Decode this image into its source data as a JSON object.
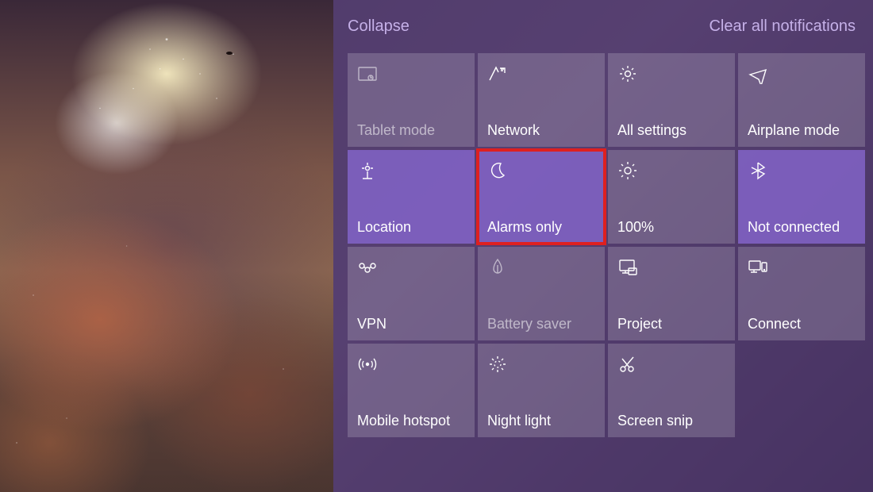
{
  "header": {
    "collapse": "Collapse",
    "clear": "Clear all notifications"
  },
  "tiles": [
    {
      "id": "tablet-mode",
      "label": "Tablet mode",
      "icon": "tablet-mode-icon",
      "active": false,
      "disabled": true,
      "highlighted": false
    },
    {
      "id": "network",
      "label": "Network",
      "icon": "network-icon",
      "active": false,
      "disabled": false,
      "highlighted": false
    },
    {
      "id": "all-settings",
      "label": "All settings",
      "icon": "gear-icon",
      "active": false,
      "disabled": false,
      "highlighted": false
    },
    {
      "id": "airplane-mode",
      "label": "Airplane mode",
      "icon": "airplane-icon",
      "active": false,
      "disabled": false,
      "highlighted": false
    },
    {
      "id": "location",
      "label": "Location",
      "icon": "location-icon",
      "active": true,
      "disabled": false,
      "highlighted": false
    },
    {
      "id": "focus-assist",
      "label": "Alarms only",
      "icon": "moon-icon",
      "active": true,
      "disabled": false,
      "highlighted": true
    },
    {
      "id": "brightness",
      "label": "100%",
      "icon": "brightness-icon",
      "active": false,
      "disabled": false,
      "highlighted": false
    },
    {
      "id": "bluetooth",
      "label": "Not connected",
      "icon": "bluetooth-icon",
      "active": true,
      "disabled": false,
      "highlighted": false
    },
    {
      "id": "vpn",
      "label": "VPN",
      "icon": "vpn-icon",
      "active": false,
      "disabled": false,
      "highlighted": false
    },
    {
      "id": "battery-saver",
      "label": "Battery saver",
      "icon": "battery-saver-icon",
      "active": false,
      "disabled": true,
      "highlighted": false
    },
    {
      "id": "project",
      "label": "Project",
      "icon": "project-icon",
      "active": false,
      "disabled": false,
      "highlighted": false
    },
    {
      "id": "connect",
      "label": "Connect",
      "icon": "connect-icon",
      "active": false,
      "disabled": false,
      "highlighted": false
    },
    {
      "id": "mobile-hotspot",
      "label": "Mobile hotspot",
      "icon": "mobile-hotspot-icon",
      "active": false,
      "disabled": false,
      "highlighted": false
    },
    {
      "id": "night-light",
      "label": "Night light",
      "icon": "night-light-icon",
      "active": false,
      "disabled": false,
      "highlighted": false
    },
    {
      "id": "screen-snip",
      "label": "Screen snip",
      "icon": "screen-snip-icon",
      "active": false,
      "disabled": false,
      "highlighted": false
    }
  ]
}
